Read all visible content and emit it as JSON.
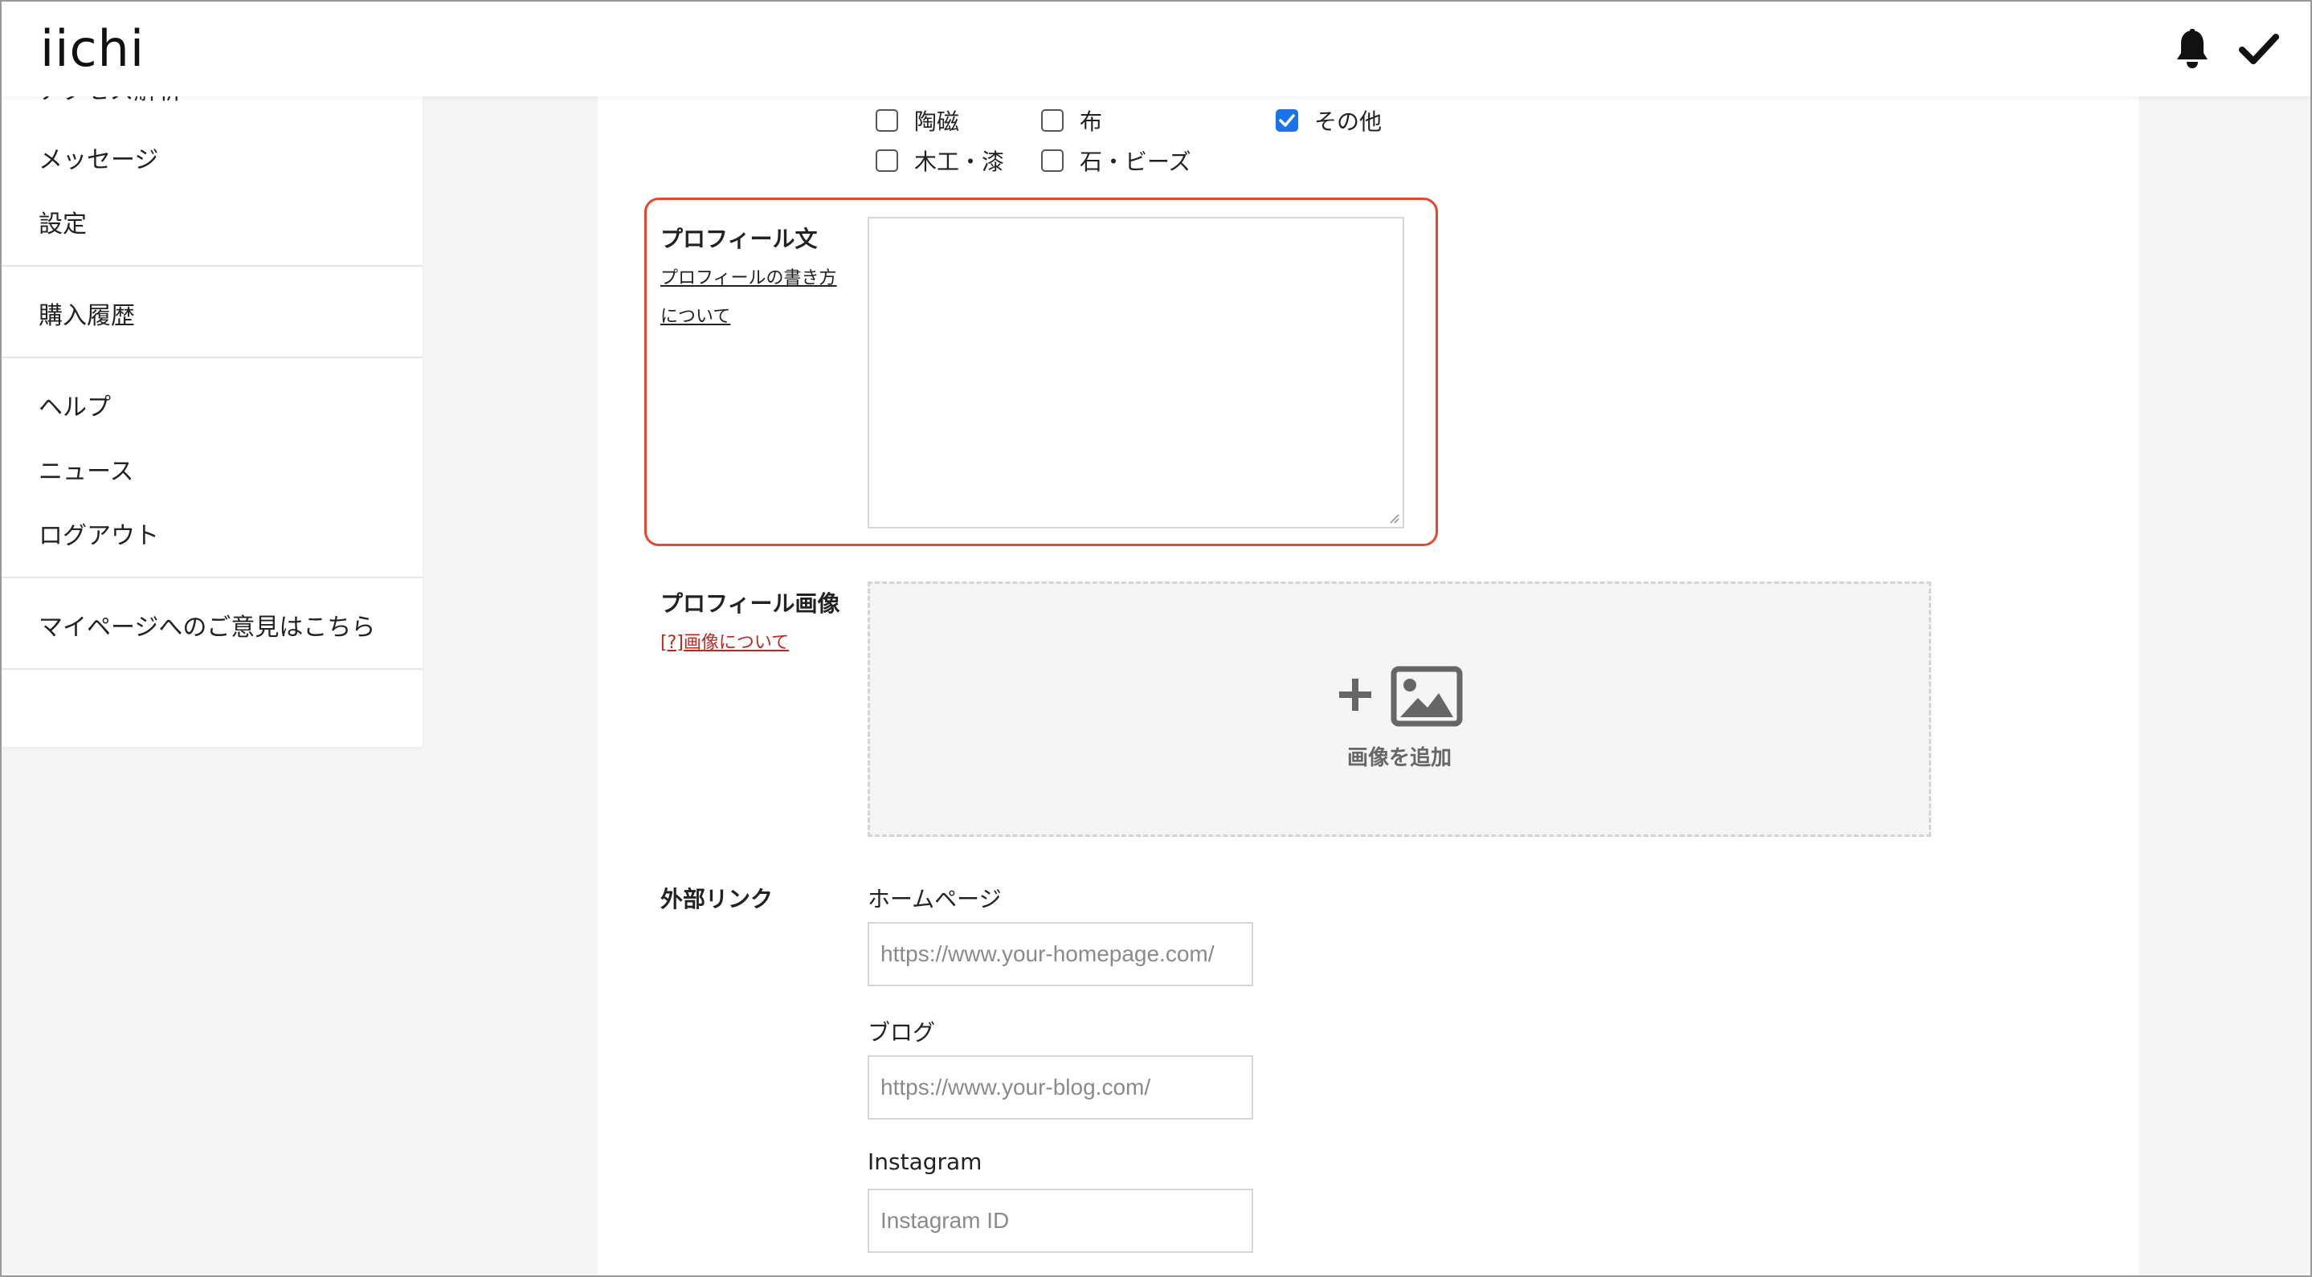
{
  "app": {
    "logo": "iichi"
  },
  "header": {
    "icons": [
      "bell-icon",
      "checkmark-icon"
    ]
  },
  "sidebar": {
    "cut_item": "アクセス解析",
    "items": [
      "メッセージ",
      "設定",
      "購入履歴",
      "ヘルプ",
      "ニュース",
      "ログアウト",
      "マイページへのご意見はこちら"
    ]
  },
  "categories": [
    {
      "label": "陶磁",
      "checked": false
    },
    {
      "label": "布",
      "checked": false
    },
    {
      "label": "その他",
      "checked": true
    },
    {
      "label": "木工・漆",
      "checked": false
    },
    {
      "label": "石・ビーズ",
      "checked": false
    }
  ],
  "profile_text": {
    "title": "プロフィール文",
    "help_link_line1": "プロフィールの書き方",
    "help_link_line2": "について",
    "value": ""
  },
  "profile_image": {
    "title": "プロフィール画像",
    "help_link": "[?]画像について",
    "add_label": "画像を追加"
  },
  "external_links": {
    "title": "外部リンク",
    "homepage": {
      "label": "ホームページ",
      "placeholder": "https://www.your-homepage.com/"
    },
    "blog": {
      "label": "ブログ",
      "placeholder": "https://www.your-blog.com/"
    },
    "instagram": {
      "label": "Instagram",
      "placeholder": "Instagram ID"
    }
  },
  "colors": {
    "accent_check": "#1a73e8",
    "highlight": "#e8452f",
    "link_red": "#c0281e"
  }
}
